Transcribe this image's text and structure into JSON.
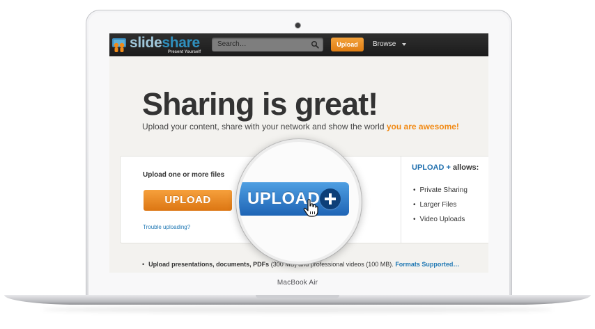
{
  "device": {
    "brand_label": "MacBook Air"
  },
  "topbar": {
    "logo_part1": "slide",
    "logo_part2": "share",
    "logo_tagline": "Present Yourself",
    "search_placeholder": "Search…",
    "upload_label": "Upload",
    "browse_label": "Browse"
  },
  "hero": {
    "title": "Sharing is great!",
    "subtitle": "Upload your content, share with your network and show the world",
    "subtitle_highlight": "you are awesome!"
  },
  "upload_panel": {
    "label": "Upload one or more files",
    "upload_button": "UPLOAD",
    "trouble_link": "Trouble uploading?"
  },
  "plus_panel": {
    "heading_brand": "UPLOAD +",
    "heading_suffix": "allows:",
    "features": [
      "Private Sharing",
      "Larger Files",
      "Video Uploads"
    ]
  },
  "magnified_button": {
    "label": "UPLOAD"
  },
  "bottom_note": {
    "bold_text": "Upload presentations, documents, PDFs",
    "rest_text": "(300 MB) and professional videos (100 MB).",
    "link_text": "Formats Supported…"
  },
  "colors": {
    "accent_orange": "#f18a15",
    "link_blue": "#1f78b4",
    "plus_blue": "#1e64b5",
    "topbar": "#1b1b1b"
  }
}
